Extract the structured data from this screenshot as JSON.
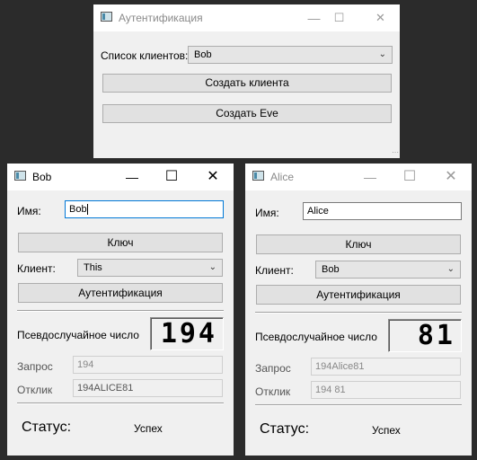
{
  "auth_window": {
    "title": "Аутентификация",
    "client_list_label": "Список клиентов:",
    "client_list_value": "Bob",
    "create_client_button": "Создать клиента",
    "create_eve_button": "Создать Eve"
  },
  "bob_window": {
    "title": "Bob",
    "name_label": "Имя:",
    "name_value": "Bob",
    "key_button": "Ключ",
    "client_label": "Клиент:",
    "client_value": "This",
    "authenticate_button": "Аутентификация",
    "pseudorandom_label": "Псевдослучайное число",
    "pseudorandom_value": "194",
    "request_label": "Запрос",
    "request_value": "194",
    "response_label": "Отклик",
    "response_value": "194ALICE81",
    "status_label": "Статус:",
    "status_value": "Успех"
  },
  "alice_window": {
    "title": "Alice",
    "name_label": "Имя:",
    "name_value": "Alice",
    "key_button": "Ключ",
    "client_label": "Клиент:",
    "client_value": "Bob",
    "authenticate_button": "Аутентификация",
    "pseudorandom_label": "Псевдослучайное число",
    "pseudorandom_value": "81",
    "request_label": "Запрос",
    "request_value": "194Alice81",
    "response_label": "Отклик",
    "response_value": "194 81",
    "status_label": "Статус:",
    "status_value": "Успех"
  },
  "window_controls": {
    "minimize": "—",
    "maximize": "☐",
    "close": "✕"
  }
}
